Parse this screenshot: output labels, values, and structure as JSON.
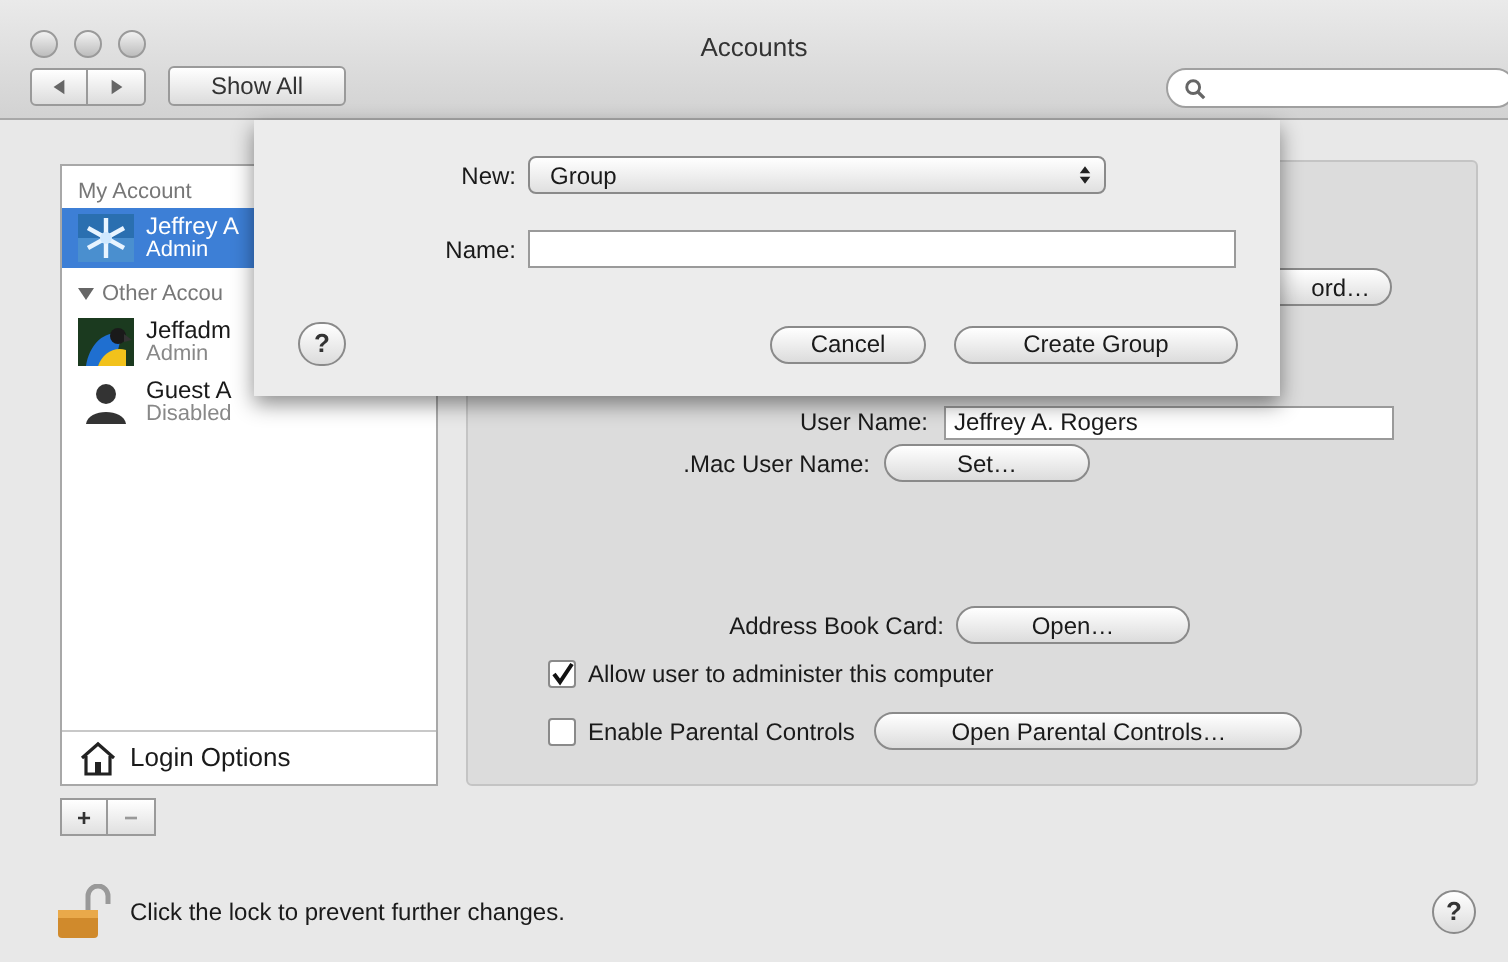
{
  "window": {
    "title": "Accounts"
  },
  "toolbar": {
    "show_all": "Show All"
  },
  "sidebar": {
    "items": [
      {
        "kind": "header",
        "label": "My Account"
      },
      {
        "kind": "user",
        "name": "Jeffrey A",
        "role": "Admin",
        "avatar": {
          "kind": "snowflake"
        },
        "selected": true
      },
      {
        "kind": "group",
        "label": "Other Accou",
        "expanded": true
      },
      {
        "kind": "user",
        "name": "Jeffadm",
        "role": "Admin",
        "avatar": {
          "kind": "parrot"
        },
        "selected": false
      },
      {
        "kind": "user",
        "name": "Guest A",
        "role": "Disabled",
        "avatar": {
          "kind": "silhouette"
        },
        "selected": false
      }
    ],
    "login_options": "Login Options",
    "buttons": [
      "+",
      "−"
    ]
  },
  "details": {
    "change_password_button": "ord…",
    "user_name_label": "User Name:",
    "user_name_value": "Jeffrey A. Rogers",
    "mac_label": ".Mac User Name:",
    "mac_button": "Set…",
    "address_label": "Address Book Card:",
    "address_button": "Open…",
    "checkboxes": [
      {
        "label": "Allow user to administer this computer",
        "checked": true
      },
      {
        "label": "Enable Parental Controls",
        "checked": false
      }
    ],
    "parental_button": "Open Parental Controls…"
  },
  "lock": {
    "locked": false,
    "text": "Click the lock to prevent further changes."
  },
  "help": "?",
  "sheet": {
    "new_label": "New:",
    "new_value": "Group",
    "name_label": "Name:",
    "help": "?",
    "buttons": [
      "Cancel",
      "Create Group"
    ]
  }
}
